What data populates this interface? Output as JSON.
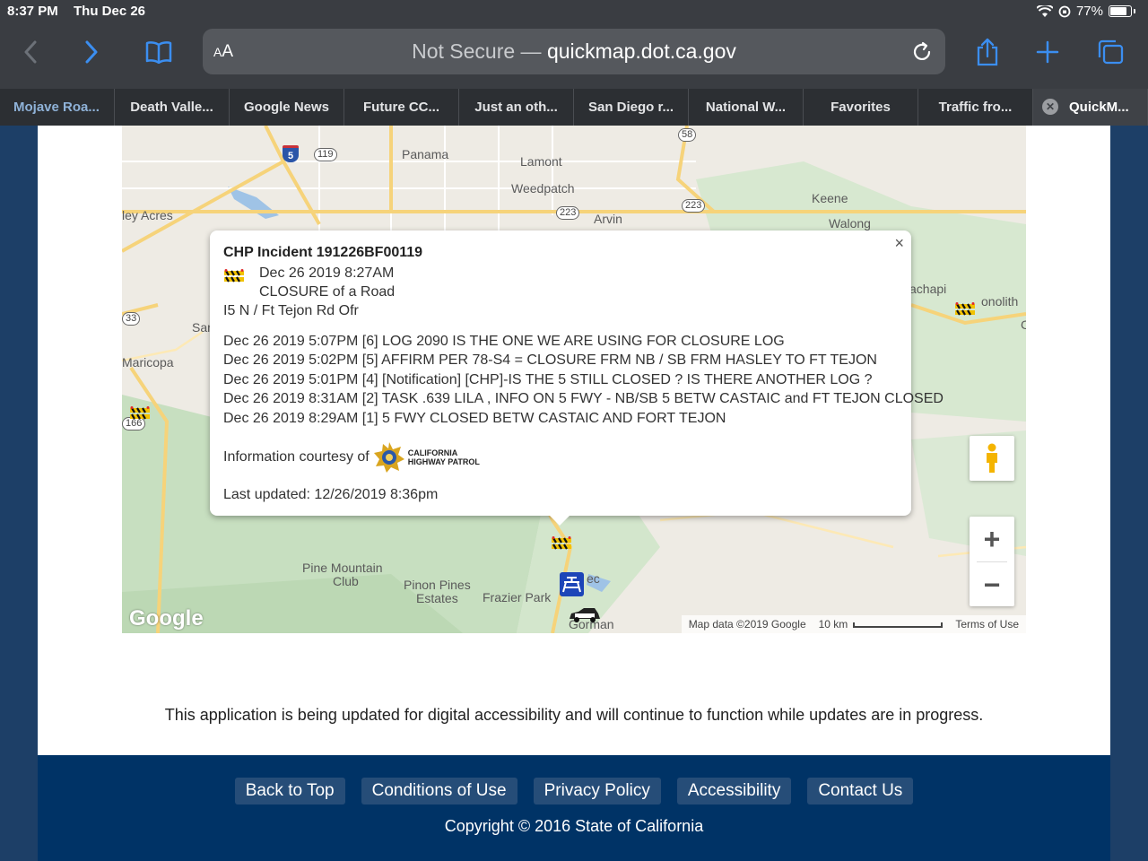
{
  "status_bar": {
    "time": "8:37 PM",
    "date": "Thu Dec 26",
    "battery": "77%"
  },
  "browser": {
    "text_size_button": "AA",
    "url_prefix": "Not Secure —",
    "url_domain": "quickmap.dot.ca.gov",
    "tabs": [
      {
        "label": "Mojave Roa..."
      },
      {
        "label": "Death Valle..."
      },
      {
        "label": "Google News"
      },
      {
        "label": "Future CC..."
      },
      {
        "label": "Just an oth..."
      },
      {
        "label": "San Diego r..."
      },
      {
        "label": "National W..."
      },
      {
        "label": "Favorites"
      },
      {
        "label": "Traffic fro..."
      },
      {
        "label": "QuickM..."
      }
    ]
  },
  "map": {
    "labels": {
      "panama": "Panama",
      "lamont": "Lamont",
      "weedpatch": "Weedpatch",
      "arvin": "Arvin",
      "keene": "Keene",
      "walong": "Walong",
      "ley_acres": "ley Acres",
      "maricopa": "Maricopa",
      "sar": "Sar",
      "achapi": "achapi",
      "onolith": "onolith",
      "pine_mountain": "Pine Mountain",
      "club": "Club",
      "pinon_pines": "Pinon Pines",
      "estates": "Estates",
      "frazier_park": "Frazier Park",
      "ec": "ec",
      "gorman": "Gorman",
      "c": "C"
    },
    "shields": {
      "i5": "5",
      "r119": "119",
      "r58": "58",
      "r223a": "223",
      "r223b": "223",
      "r33": "33",
      "r166": "166"
    },
    "google_logo": "Google",
    "attribution": "Map data ©2019 Google",
    "scale": "10 km",
    "terms": "Terms of Use",
    "zoom_in": "+",
    "zoom_out": "−"
  },
  "incident": {
    "title": "CHP Incident 191226BF00119",
    "datetime": "Dec 26 2019 8:27AM",
    "type": "CLOSURE of a Road",
    "location": "I5 N / Ft Tejon Rd Ofr",
    "log": [
      "Dec 26 2019 5:07PM [6] LOG 2090 IS THE ONE WE ARE USING FOR CLOSURE LOG",
      "Dec 26 2019 5:02PM [5] AFFIRM PER 78-S4 = CLOSURE FRM NB / SB FRM HASLEY TO FT TEJON",
      "Dec 26 2019 5:01PM [4] [Notification] [CHP]-IS THE 5 STILL CLOSED ? IS THERE ANOTHER LOG ?",
      "Dec 26 2019 8:31AM [2] TASK .639 LILA , INFO ON 5 FWY - NB/SB 5 BETW CASTAIC and FT TEJON CLOSED",
      "Dec 26 2019 8:29AM [1] 5 FWY CLOSED BETW CASTAIC AND FORT TEJON"
    ],
    "courtesy": "Information courtesy of",
    "chp_line1": "CALIFORNIA",
    "chp_line2": "HIGHWAY PATROL",
    "last_updated": "Last updated: 12/26/2019 8:36pm",
    "close": "×"
  },
  "notice": "This application is being updated for digital accessibility and will continue to function while updates are in progress.",
  "footer": {
    "links": [
      "Back to Top",
      "Conditions of Use",
      "Privacy Policy",
      "Accessibility",
      "Contact Us"
    ],
    "copyright": "Copyright © 2016 State of California"
  },
  "colors": {
    "footer_bg": "#003366",
    "footer_button": "#264d78",
    "page_bg": "#1d3f67",
    "chrome_bg": "#3a3d42",
    "link_blue": "#4a90e2"
  }
}
